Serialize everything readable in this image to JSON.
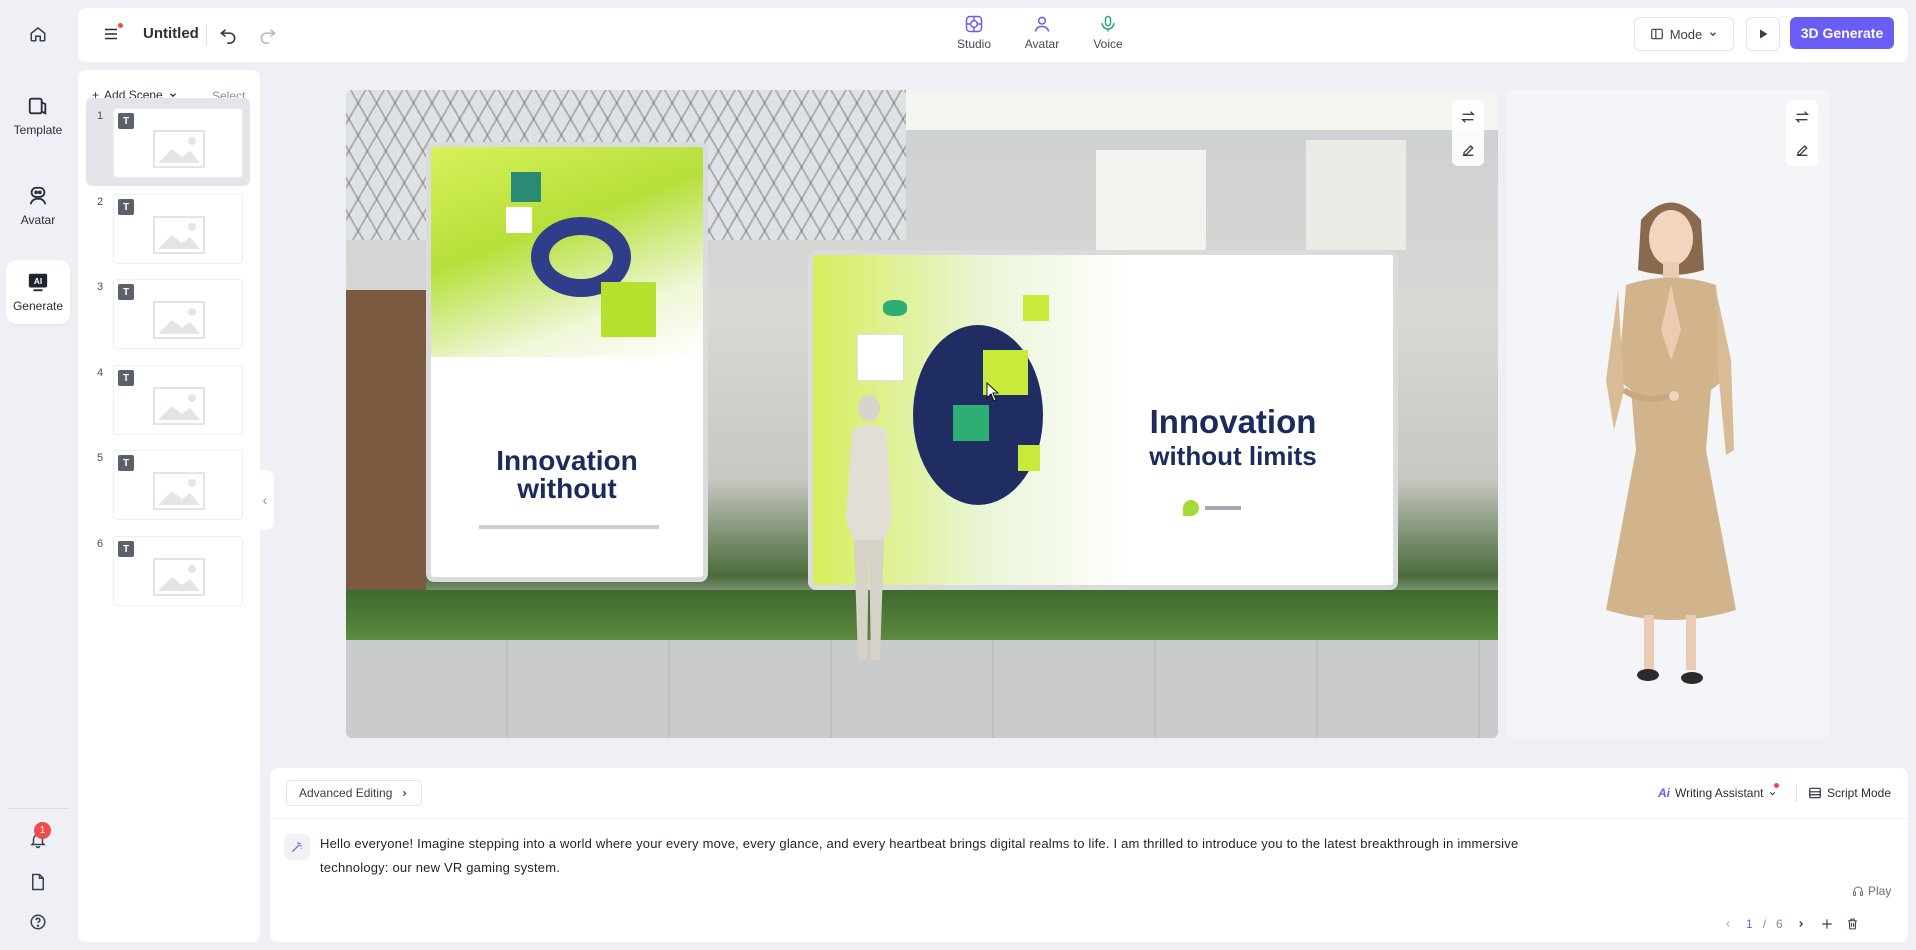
{
  "document": {
    "title": "Untitled"
  },
  "rail": {
    "items": [
      {
        "label": "Template",
        "icon": "template-icon"
      },
      {
        "label": "Avatar",
        "icon": "avatar-icon"
      },
      {
        "label": "Generate",
        "icon": "ai-generate-icon",
        "active": true
      }
    ],
    "notification_count": "1"
  },
  "topbar": {
    "tabs": [
      {
        "label": "Studio",
        "icon": "studio-icon"
      },
      {
        "label": "Avatar",
        "icon": "avatar-icon"
      },
      {
        "label": "Voice",
        "icon": "microphone-icon"
      }
    ],
    "mode_label": "Mode",
    "generate_label": "3D Generate"
  },
  "scenes": {
    "add_label": "Add Scene",
    "select_label": "Select",
    "badge": "T",
    "items": [
      "1",
      "2",
      "3",
      "4",
      "5",
      "6"
    ],
    "active_index": 0
  },
  "stage": {
    "left_panel_headline": "Innovation without",
    "right_panel_headline_1": "Innovation",
    "right_panel_headline_2": "without limits"
  },
  "editor": {
    "advanced_label": "Advanced Editing",
    "writing_assistant_badge": "Ai",
    "writing_assistant_label": "Writing Assistant",
    "script_mode_label": "Script Mode",
    "script_text": "Hello everyone! Imagine stepping into a world where your every move, every glance, and every heartbeat brings digital realms to life. I am thrilled to introduce you to the latest breakthrough in immersive technology: our new VR gaming system.",
    "play_label": "Play",
    "page_current": "1",
    "page_separator": "/",
    "page_total": "6"
  },
  "colors": {
    "accent": "#6b5cf5",
    "badge": "#ef4b4b"
  }
}
